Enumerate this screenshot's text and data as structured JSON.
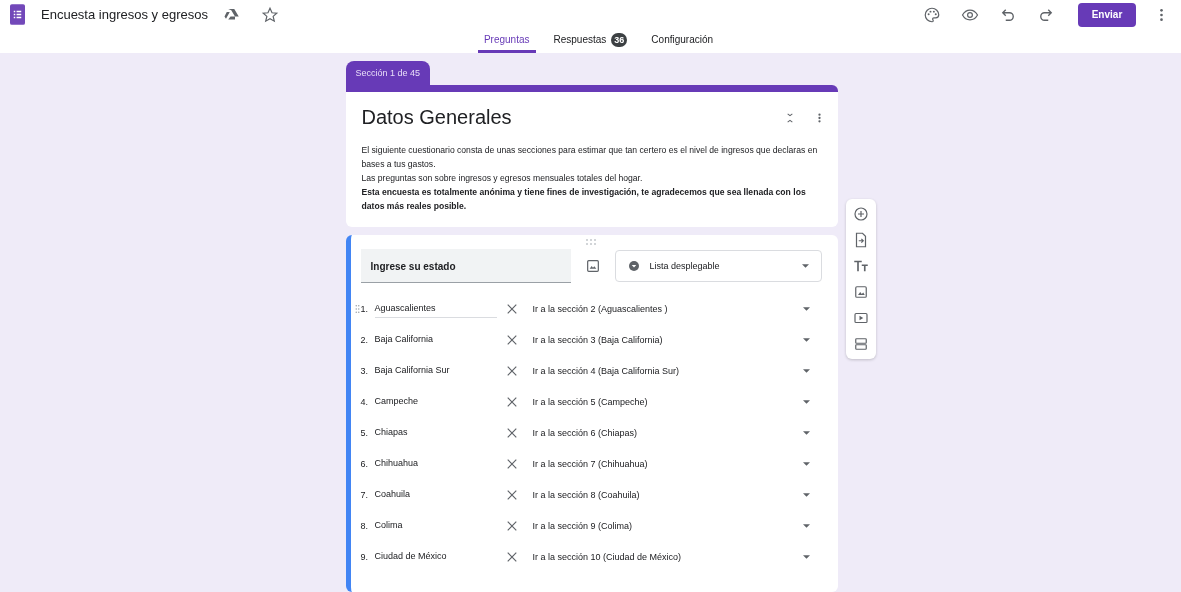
{
  "header": {
    "title": "Encuesta ingresos y egresos",
    "send_button": "Enviar"
  },
  "tabs": [
    {
      "label": "Preguntas",
      "selected": true
    },
    {
      "label": "Respuestas",
      "selected": false,
      "badge": "36"
    },
    {
      "label": "Configuración",
      "selected": false
    }
  ],
  "section": {
    "tab": "Sección 1 de 45",
    "title": "Datos Generales",
    "description": [
      {
        "text": "El siguiente cuestionario consta de unas secciones para estimar que tan certero es el nivel de ingresos que declaras en bases a tus gastos.",
        "bold": false
      },
      {
        "text": "Las preguntas son sobre ingresos y egresos mensuales totales del hogar.",
        "bold": false
      },
      {
        "text": "Esta encuesta es totalmente anónima y tiene fines de investigación, te agradecemos que sea llenada con los datos más reales posible.",
        "bold": true
      }
    ]
  },
  "question": {
    "title": "Ingrese su estado",
    "type": "Lista desplegable",
    "options": [
      {
        "number": "1.",
        "label": "Aguascalientes",
        "destination": "Ir a la sección 2 (Aguascalientes )",
        "selected": true
      },
      {
        "number": "2.",
        "label": "Baja California",
        "destination": "Ir a la sección 3 (Baja California)",
        "selected": false
      },
      {
        "number": "3.",
        "label": "Baja California Sur",
        "destination": "Ir a la sección 4 (Baja California Sur)",
        "selected": false
      },
      {
        "number": "4.",
        "label": "Campeche",
        "destination": "Ir a la sección 5 (Campeche)",
        "selected": false
      },
      {
        "number": "5.",
        "label": "Chiapas",
        "destination": "Ir a la sección 6 (Chiapas)",
        "selected": false
      },
      {
        "number": "6.",
        "label": "Chihuahua",
        "destination": "Ir a la sección 7 (Chihuahua)",
        "selected": false
      },
      {
        "number": "7.",
        "label": "Coahuila",
        "destination": "Ir a la sección 8 (Coahuila)",
        "selected": false
      },
      {
        "number": "8.",
        "label": "Colima",
        "destination": "Ir a la sección 9 (Colima)",
        "selected": false
      },
      {
        "number": "9.",
        "label": "Ciudad de México",
        "destination": "Ir a la sección 10 (Ciudad de México)",
        "selected": false
      }
    ]
  }
}
